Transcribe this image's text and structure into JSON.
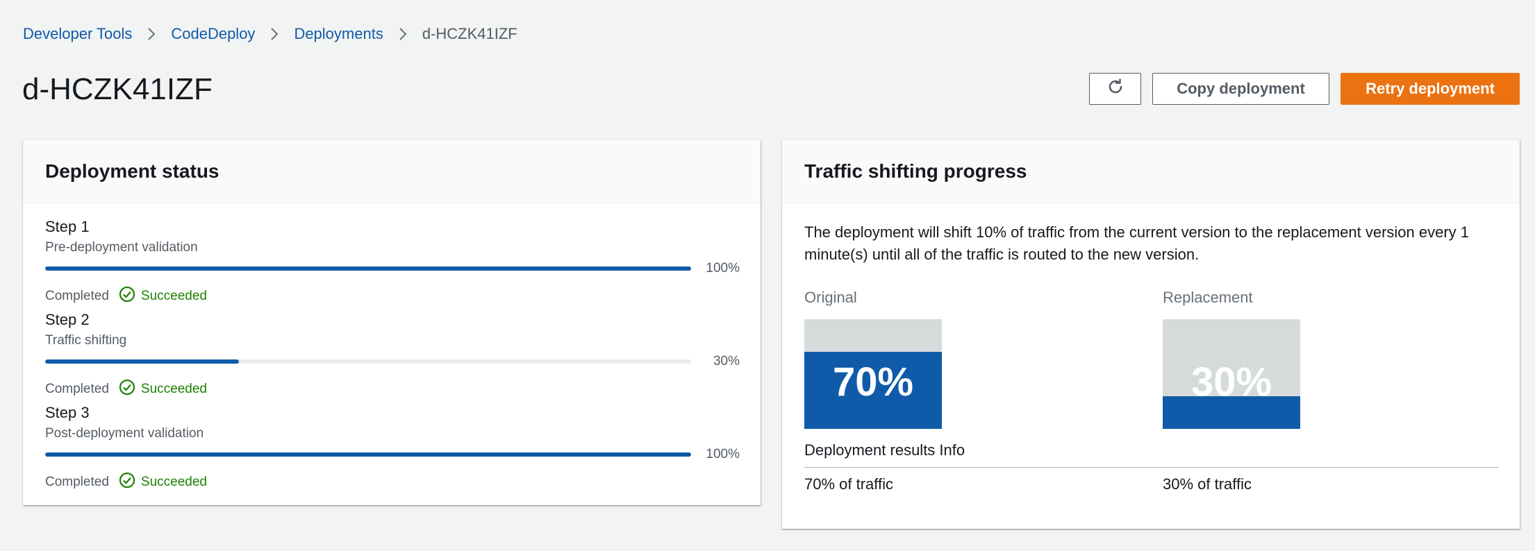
{
  "breadcrumb": {
    "items": [
      "Developer Tools",
      "CodeDeploy",
      "Deployments"
    ],
    "current": "d-HCZK41IZF"
  },
  "page": {
    "title": "d-HCZK41IZF"
  },
  "actions": {
    "refresh_icon": "refresh-icon",
    "copy_label": "Copy deployment",
    "retry_label": "Retry deployment"
  },
  "deployment_status": {
    "title": "Deployment status",
    "steps": [
      {
        "title": "Step 1",
        "subtitle": "Pre-deployment validation",
        "progress": 100,
        "progress_label": "100%",
        "state": "Completed",
        "result": "Succeeded"
      },
      {
        "title": "Step 2",
        "subtitle": "Traffic shifting",
        "progress": 30,
        "progress_label": "30%",
        "state": "Completed",
        "result": "Succeeded"
      },
      {
        "title": "Step 3",
        "subtitle": "Post-deployment validation",
        "progress": 100,
        "progress_label": "100%",
        "state": "Completed",
        "result": "Succeeded"
      }
    ]
  },
  "traffic": {
    "title": "Traffic shifting progress",
    "description": "The deployment will shift 10% of traffic from the current version to the replacement version every 1 minute(s) until all of the traffic is routed to the new version.",
    "original": {
      "label": "Original",
      "percent": 70,
      "percent_label": "70%",
      "result": "70% of traffic"
    },
    "replacement": {
      "label": "Replacement",
      "percent": 30,
      "percent_label": "30%",
      "result": "30% of traffic"
    },
    "results_title": "Deployment results Info"
  },
  "colors": {
    "link": "#0f5ba9",
    "primary": "#ec7211",
    "success": "#1d8102",
    "progress": "#0f5ba9",
    "bucket_empty": "#d5dbdb"
  }
}
